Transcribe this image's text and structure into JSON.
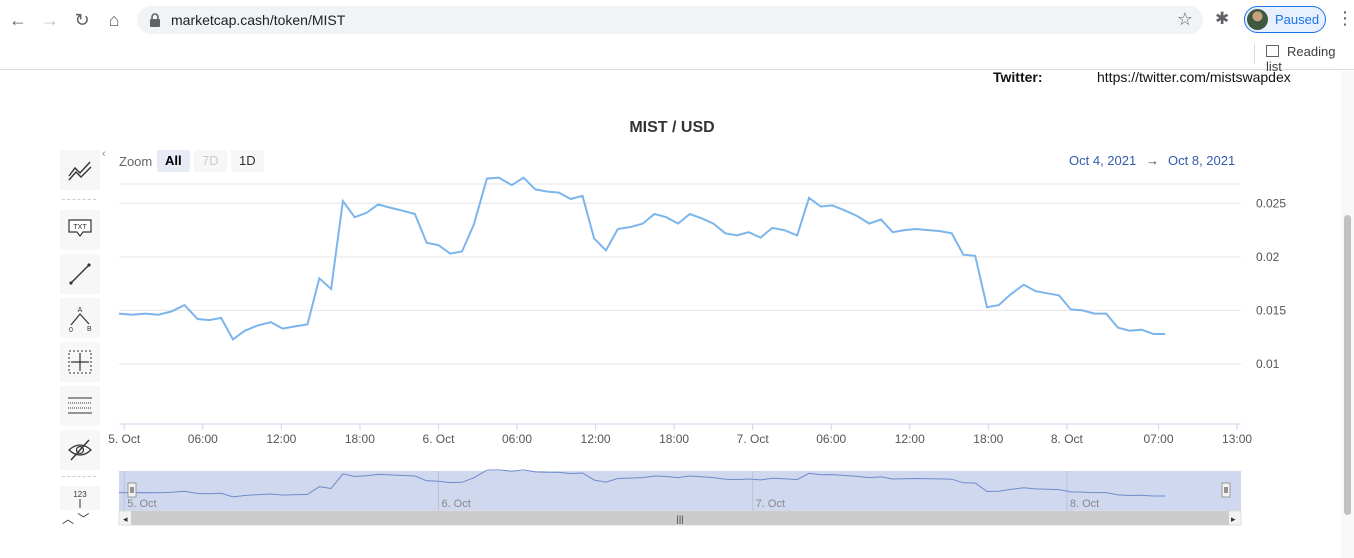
{
  "browser": {
    "url": "marketcap.cash/token/MIST",
    "profile_label": "Paused",
    "reading_list": "Reading list",
    "back_icon": "arrow-left-icon",
    "forward_icon": "arrow-right-icon",
    "reload_icon": "reload-icon",
    "home_icon": "home-icon"
  },
  "page": {
    "twitter_label": "Twitter:",
    "twitter_value": "https://twitter.com/mistswapdex"
  },
  "chart_controls": {
    "zoom_label": "Zoom",
    "buttons": [
      "All",
      "7D",
      "1D"
    ],
    "range_from": "Oct 4, 2021",
    "range_arrow": "→",
    "range_to": "Oct 8, 2021"
  },
  "toolbar": {
    "txt_label": "TXT",
    "counter_label": "123"
  },
  "colors": {
    "line": "#7cb5ec",
    "navigator_fill": "#cfd8ee",
    "grid": "#e6e6e6",
    "accent": "#335cad"
  },
  "chart_data": {
    "type": "line",
    "title": "MIST / USD",
    "y_ticks": [
      "0.025",
      "0.02",
      "0.015",
      "0.01"
    ],
    "y_tick_values": [
      0.025,
      0.02,
      0.015,
      0.01
    ],
    "ylim": [
      0.0044,
      0.0268
    ],
    "x_ticks": [
      {
        "label": "5. Oct",
        "t": 4
      },
      {
        "label": "06:00",
        "t": 10
      },
      {
        "label": "12:00",
        "t": 16
      },
      {
        "label": "18:00",
        "t": 22
      },
      {
        "label": "6. Oct",
        "t": 28
      },
      {
        "label": "06:00",
        "t": 34
      },
      {
        "label": "12:00",
        "t": 40
      },
      {
        "label": "18:00",
        "t": 46
      },
      {
        "label": "7. Oct",
        "t": 52
      },
      {
        "label": "06:00",
        "t": 58
      },
      {
        "label": "12:00",
        "t": 64
      },
      {
        "label": "18:00",
        "t": 70
      },
      {
        "label": "8. Oct",
        "t": 76
      },
      {
        "label": "07:00",
        "t": 83
      },
      {
        "label": "13:00",
        "t": 89
      }
    ],
    "navigator_labels": [
      {
        "label": "5. Oct",
        "t": 4
      },
      {
        "label": "6. Oct",
        "t": 28
      },
      {
        "label": "7. Oct",
        "t": 52
      },
      {
        "label": "8. Oct",
        "t": 76
      }
    ],
    "x_range_hours": [
      3.6,
      89.3
    ],
    "series": [
      {
        "values": [
          [
            3.6,
            0.0147
          ],
          [
            4.6,
            0.0146
          ],
          [
            5.6,
            0.0147
          ],
          [
            6.6,
            0.0146
          ],
          [
            7.6,
            0.0149
          ],
          [
            8.6,
            0.0155
          ],
          [
            9.6,
            0.0142
          ],
          [
            10.5,
            0.0141
          ],
          [
            11.4,
            0.0143
          ],
          [
            12.3,
            0.0123
          ],
          [
            13.2,
            0.0131
          ],
          [
            14.2,
            0.0136
          ],
          [
            15.2,
            0.0139
          ],
          [
            16.1,
            0.0133
          ],
          [
            17.0,
            0.0135
          ],
          [
            18.0,
            0.0137
          ],
          [
            18.9,
            0.018
          ],
          [
            19.8,
            0.017
          ],
          [
            20.7,
            0.0252
          ],
          [
            21.6,
            0.0237
          ],
          [
            22.5,
            0.0241
          ],
          [
            23.4,
            0.0249
          ],
          [
            24.3,
            0.0246
          ],
          [
            25.3,
            0.0243
          ],
          [
            26.2,
            0.024
          ],
          [
            27.1,
            0.0213
          ],
          [
            28.0,
            0.0211
          ],
          [
            28.9,
            0.0203
          ],
          [
            29.8,
            0.0205
          ],
          [
            30.7,
            0.023
          ],
          [
            31.7,
            0.0273
          ],
          [
            32.6,
            0.0274
          ],
          [
            33.6,
            0.0267
          ],
          [
            34.5,
            0.0274
          ],
          [
            35.4,
            0.0263
          ],
          [
            36.3,
            0.0261
          ],
          [
            37.2,
            0.026
          ],
          [
            38.1,
            0.0254
          ],
          [
            39.0,
            0.0257
          ],
          [
            39.9,
            0.0217
          ],
          [
            40.8,
            0.0206
          ],
          [
            41.7,
            0.0226
          ],
          [
            42.7,
            0.0228
          ],
          [
            43.6,
            0.0231
          ],
          [
            44.5,
            0.024
          ],
          [
            45.4,
            0.0237
          ],
          [
            46.3,
            0.0231
          ],
          [
            47.2,
            0.024
          ],
          [
            48.1,
            0.0236
          ],
          [
            49.0,
            0.0231
          ],
          [
            49.9,
            0.0222
          ],
          [
            50.8,
            0.022
          ],
          [
            51.7,
            0.0223
          ],
          [
            52.6,
            0.0218
          ],
          [
            53.5,
            0.0227
          ],
          [
            54.4,
            0.0225
          ],
          [
            55.4,
            0.022
          ],
          [
            56.3,
            0.0255
          ],
          [
            57.2,
            0.0247
          ],
          [
            58.1,
            0.0248
          ],
          [
            59.1,
            0.0243
          ],
          [
            60.0,
            0.0238
          ],
          [
            60.9,
            0.0231
          ],
          [
            61.8,
            0.0235
          ],
          [
            62.7,
            0.0223
          ],
          [
            63.6,
            0.0225
          ],
          [
            64.5,
            0.0226
          ],
          [
            65.4,
            0.0225
          ],
          [
            66.3,
            0.0224
          ],
          [
            67.2,
            0.0222
          ],
          [
            68.1,
            0.0202
          ],
          [
            69.0,
            0.0201
          ],
          [
            69.9,
            0.0153
          ],
          [
            70.8,
            0.0155
          ],
          [
            71.7,
            0.0165
          ],
          [
            72.7,
            0.0174
          ],
          [
            73.6,
            0.0168
          ],
          [
            74.5,
            0.0166
          ],
          [
            75.4,
            0.0164
          ],
          [
            76.3,
            0.0151
          ],
          [
            77.2,
            0.015
          ],
          [
            78.1,
            0.0147
          ],
          [
            79.0,
            0.0147
          ],
          [
            79.9,
            0.0134
          ],
          [
            80.8,
            0.0131
          ],
          [
            81.7,
            0.0132
          ],
          [
            82.6,
            0.0128
          ],
          [
            83.5,
            0.0128
          ]
        ]
      }
    ],
    "grid": true,
    "legend": "none",
    "navigator": true
  }
}
